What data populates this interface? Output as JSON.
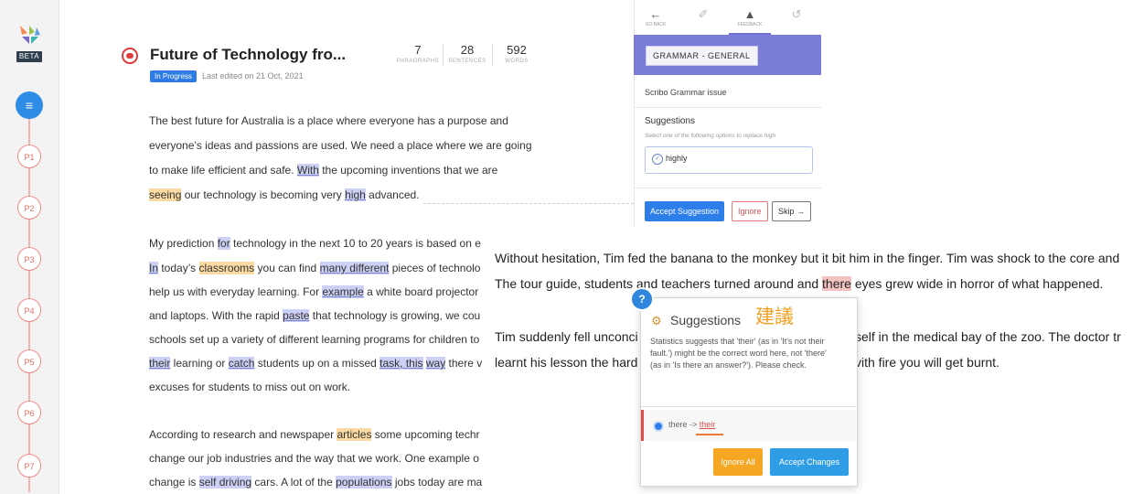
{
  "rail": {
    "beta": "BETA",
    "nodes": [
      "P1",
      "P2",
      "P3",
      "P4",
      "P5",
      "P6",
      "P7"
    ]
  },
  "doc": {
    "title": "Future of Technology fro...",
    "status": "In Progress",
    "edited": "Last edited on 21 Oct, 2021",
    "stats": [
      {
        "value": "7",
        "label": "PARAGRAPHS"
      },
      {
        "value": "28",
        "label": "SENTENCES"
      },
      {
        "value": "592",
        "label": "WORDS"
      }
    ],
    "lines": {
      "l1": "The best future for Australia is a place where everyone has a purpose and",
      "l2": "everyone’s ideas and passions are used. We need a place where we are going",
      "l3a": "to make life efficient and safe. ",
      "l3b": "With",
      "l3c": " the upcoming inventions that we are",
      "l4a": "seeing",
      "l4b": " our technology is becoming very ",
      "l4c": "high",
      "l4d": " advanced.",
      "p2l1a": "My prediction ",
      "p2l1b": "for",
      "p2l1c": " technology in the next 10 to 20 years is based on e",
      "p2l2a": "In",
      "p2l2b": " today’s ",
      "p2l2c": "classrooms",
      "p2l2d": " you can find ",
      "p2l2e": "many different",
      "p2l2f": " pieces of technolo",
      "p2l3a": "help us with everyday learning. For ",
      "p2l3b": "example",
      "p2l3c": " a white board projector",
      "p2l4a": "and laptops. With the rapid ",
      "p2l4b": "paste",
      "p2l4c": " that technology is growing, we cou",
      "p2l5": "schools set up a variety of different learning programs for children to",
      "p2l6a": "their",
      "p2l6b": " learning or ",
      "p2l6c": "catch",
      "p2l6d": " students up on a missed ",
      "p2l6e": "task, this",
      "p2l6f": " ",
      "p2l6g": "way",
      "p2l6h": " there v",
      "p2l7": "excuses for students to miss out on work.",
      "p3l1a": "According to research and newspaper ",
      "p3l1b": "articles",
      "p3l1c": " some upcoming techr",
      "p3l2": "change our job industries and the way that we work. One example o",
      "p3l3a": "change is ",
      "p3l3b": "self driving",
      "p3l3c": " cars. A lot of the ",
      "p3l3d": "populations",
      "p3l3e": " jobs today are ma"
    }
  },
  "feedback": {
    "tabs": [
      "GO BACK",
      "",
      "FEEDBACK",
      ""
    ],
    "tab_icons": [
      "←",
      "✐",
      "▲",
      "↺"
    ],
    "category": "GRAMMAR - GENERAL",
    "issue": "Scribo Grammar issue",
    "suggestions_heading": "Suggestions",
    "suggestions_hint": "Select one of the following options to replace high",
    "option": "highly",
    "accept": "Accept Suggestion",
    "ignore": "Ignore",
    "skip": "Skip →"
  },
  "shot2": {
    "l1": "Without hesitation, Tim fed the banana to the monkey but it bit him in the finger. Tim was shock to the core and",
    "l2a": "The tour guide, students and teachers turned around and ",
    "l2b": "there",
    "l2c": " eyes grew wide in horror of what happened.",
    "l3a": "Tim suddenly fell unconci",
    "l3b": "self in the medical bay of the zoo. The doctor tr",
    "l4a": "learnt his lesson the hard",
    "l4b": "vith fire you will get burnt."
  },
  "popup": {
    "badge": "?",
    "title": "Suggestions",
    "cjk": "建議",
    "body": "Statistics suggests that 'their' (as in 'It's not their fault.') might be the correct word here, not 'there' (as in 'Is there an answer?'). Please check.",
    "replace_from": "there ->",
    "replace_to": "their",
    "ignore_all": "Ignore All",
    "accept_changes": "Accept Changes"
  }
}
